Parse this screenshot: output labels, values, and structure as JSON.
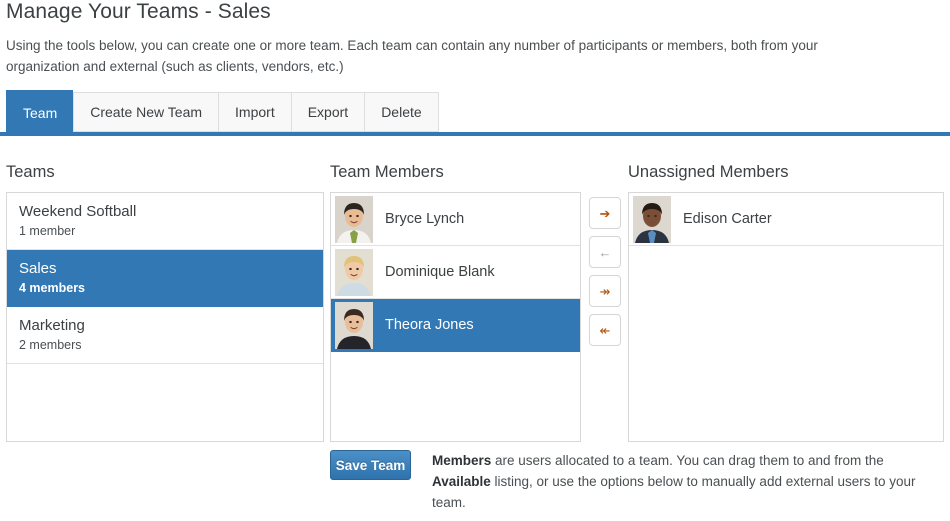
{
  "header": {
    "title": "Manage Your Teams - Sales",
    "description": "Using the tools below, you can create one or more team. Each team can contain any number of participants or members, both from your organization and external (such as clients, vendors, etc.)"
  },
  "tabs": [
    {
      "label": "Team",
      "active": true
    },
    {
      "label": "Create New Team",
      "active": false
    },
    {
      "label": "Import",
      "active": false
    },
    {
      "label": "Export",
      "active": false
    },
    {
      "label": "Delete",
      "active": false
    }
  ],
  "columns": {
    "teams_heading": "Teams",
    "members_heading": "Team Members",
    "unassigned_heading": "Unassigned Members"
  },
  "teams": [
    {
      "name": "Weekend Softball",
      "count": "1 member",
      "selected": false
    },
    {
      "name": "Sales",
      "count": "4 members",
      "selected": true
    },
    {
      "name": "Marketing",
      "count": "2 members",
      "selected": false
    }
  ],
  "team_members": [
    {
      "name": "Bryce Lynch",
      "selected": false,
      "avatar": "asian-man-white-shirt-green-tie"
    },
    {
      "name": "Dominique Blank",
      "selected": false,
      "avatar": "blonde-woman-smiling"
    },
    {
      "name": "Theora Jones",
      "selected": true,
      "avatar": "dark-hair-woman-black-jacket"
    }
  ],
  "unassigned_members": [
    {
      "name": "Edison Carter",
      "selected": false,
      "avatar": "black-man-suit-blue-shirt"
    }
  ],
  "transfer_buttons": [
    {
      "name": "move-right",
      "icon": "arrow-right-icon",
      "glyph": "➔",
      "state": "enabled"
    },
    {
      "name": "move-left",
      "icon": "arrow-left-icon",
      "glyph": "←",
      "state": "disabled"
    },
    {
      "name": "move-all-right",
      "icon": "double-arrow-right-icon",
      "glyph": "↠",
      "state": "enabled"
    },
    {
      "name": "move-all-left",
      "icon": "double-arrow-left-icon",
      "glyph": "↞",
      "state": "enabled"
    }
  ],
  "actions": {
    "save_label": "Save Team"
  },
  "help": {
    "bold1": "Members",
    "text1": " are users allocated to a team. You can drag them to and from the ",
    "bold2": "Available",
    "text2": " listing, or use the options below to manually add external users to your team."
  },
  "colors": {
    "accent": "#3178b4",
    "tab_inactive_bg": "#f8f8f8",
    "panel_border": "#d8d8d8",
    "text": "#3c4144"
  }
}
